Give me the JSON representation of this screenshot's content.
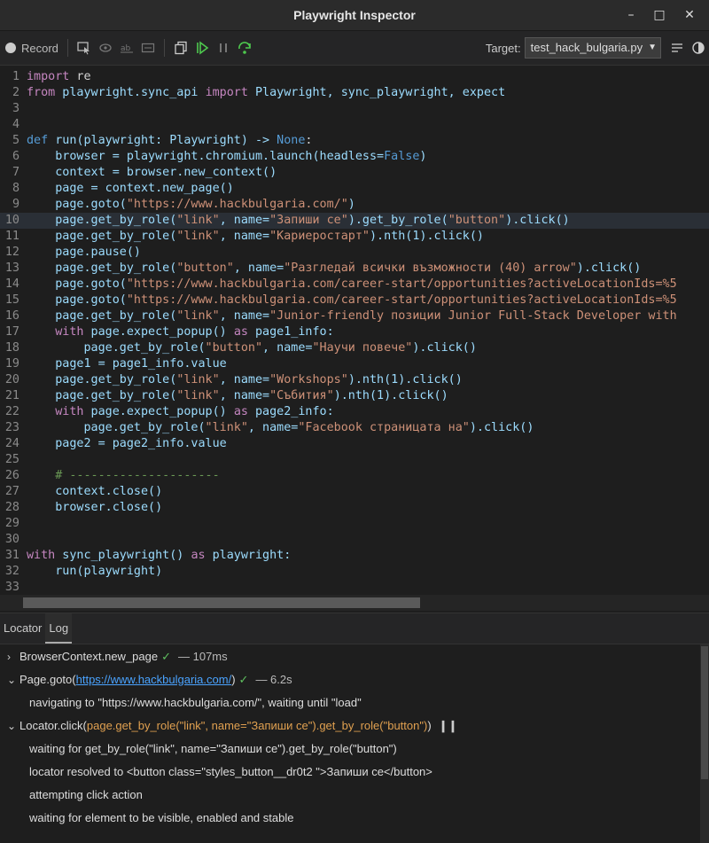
{
  "window": {
    "title": "Playwright Inspector",
    "minimize": "–",
    "maximize": "□",
    "close": "✕"
  },
  "toolbar": {
    "record_label": "Record",
    "target_label": "Target:",
    "target_value": "test_hack_bulgaria.py"
  },
  "tabs": [
    {
      "label": "Locator"
    },
    {
      "label": "Log"
    }
  ],
  "code_lines": [
    "1",
    "2",
    "3",
    "4",
    "5",
    "6",
    "7",
    "8",
    "9",
    "10",
    "11",
    "12",
    "13",
    "14",
    "15",
    "16",
    "17",
    "18",
    "19",
    "20",
    "21",
    "22",
    "23",
    "24",
    "25",
    "26",
    "27",
    "28",
    "29",
    "30",
    "31",
    "32",
    "33"
  ],
  "code": {
    "l1a": "import",
    "l1b": " re",
    "l2a": "from",
    "l2b": " playwright.sync_api ",
    "l2c": "import",
    "l2d": " Playwright, sync_playwright, expect",
    "l5a": "def",
    "l5b": " run(playwright: Playwright) -> ",
    "l5c": "None",
    "l5d": ":",
    "l6a": "    browser = playwright.chromium.launch(headless=",
    "l6b": "False",
    "l6c": ")",
    "l7": "    context = browser.new_context()",
    "l8": "    page = context.new_page()",
    "l9a": "    page.goto(",
    "l9b": "\"https://www.hackbulgaria.com/\"",
    "l9c": ")",
    "l10a": "    page.get_by_role(",
    "l10b": "\"link\"",
    "l10c": ", name=",
    "l10d": "\"Запиши се\"",
    "l10e": ").get_by_role(",
    "l10f": "\"button\"",
    "l10g": ").click()",
    "l11a": "    page.get_by_role(",
    "l11b": "\"link\"",
    "l11c": ", name=",
    "l11d": "\"Кариеростарт\"",
    "l11e": ").nth(1).click()",
    "l12": "    page.pause()",
    "l13a": "    page.get_by_role(",
    "l13b": "\"button\"",
    "l13c": ", name=",
    "l13d": "\"Разгледай всички възможности (40) arrow\"",
    "l13e": ").click()",
    "l14a": "    page.goto(",
    "l14b": "\"https://www.hackbulgaria.com/career-start/opportunities?activeLocationIds=%5",
    "l15a": "    page.goto(",
    "l15b": "\"https://www.hackbulgaria.com/career-start/opportunities?activeLocationIds=%5",
    "l16a": "    page.get_by_role(",
    "l16b": "\"link\"",
    "l16c": ", name=",
    "l16d": "\"Junior-friendly позиции Junior Full-Stack Developer with",
    "l17a": "    ",
    "l17b": "with",
    "l17c": " page.expect_popup() ",
    "l17d": "as",
    "l17e": " page1_info:",
    "l18a": "        page.get_by_role(",
    "l18b": "\"button\"",
    "l18c": ", name=",
    "l18d": "\"Научи повече\"",
    "l18e": ").click()",
    "l19": "    page1 = page1_info.value",
    "l20a": "    page.get_by_role(",
    "l20b": "\"link\"",
    "l20c": ", name=",
    "l20d": "\"Workshops\"",
    "l20e": ").nth(1).click()",
    "l21a": "    page.get_by_role(",
    "l21b": "\"link\"",
    "l21c": ", name=",
    "l21d": "\"Събития\"",
    "l21e": ").nth(1).click()",
    "l22a": "    ",
    "l22b": "with",
    "l22c": " page.expect_popup() ",
    "l22d": "as",
    "l22e": " page2_info:",
    "l23a": "        page.get_by_role(",
    "l23b": "\"link\"",
    "l23c": ", name=",
    "l23d": "\"Facebook страницата на\"",
    "l23e": ").click()",
    "l24": "    page2 = page2_info.value",
    "l26": "    # ---------------------",
    "l27": "    context.close()",
    "l28": "    browser.close()",
    "l31a": "with",
    "l31b": " sync_playwright() ",
    "l31c": "as",
    "l31d": " playwright:",
    "l32": "    run(playwright)"
  },
  "log": {
    "e1_name": "BrowserContext.new_page",
    "e1_dur": "— 107ms",
    "e2_name": "Page.goto(",
    "e2_link": "https://www.hackbulgaria.com/",
    "e2_close": ")",
    "e2_dur": "— 6.2s",
    "e2_sub": "navigating to \"https://www.hackbulgaria.com/\", waiting until \"load\"",
    "e3_name": "Locator.click(",
    "e3_arg": "page.get_by_role(\"link\", name=\"Запиши се\").get_by_role(\"button\")",
    "e3_close": ")",
    "e3_sub1": "waiting for get_by_role(\"link\", name=\"Запиши се\").get_by_role(\"button\")",
    "e3_sub2": "locator resolved to <button class=\"styles_button__dr0t2  \">Запиши се</button>",
    "e3_sub3": "attempting click action",
    "e3_sub4": "waiting for element to be visible, enabled and stable"
  }
}
